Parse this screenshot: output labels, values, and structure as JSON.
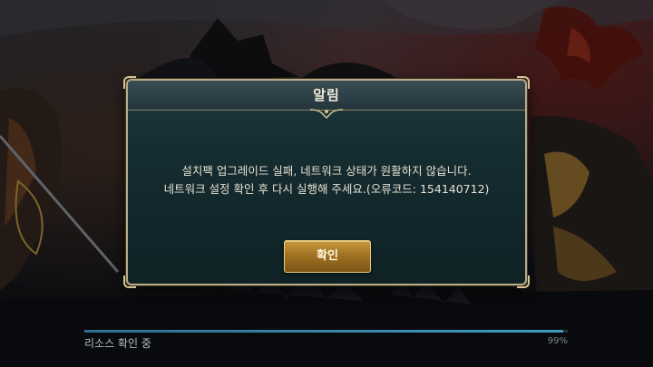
{
  "dialog": {
    "title": "알림",
    "message_line1": "설치팩 업그레이드 실패, 네트워크 상태가 원활하지 않습니다.",
    "message_line2": "네트워크 설정 확인 후 다시 실행해 주세요.(오류코드: 154140712)",
    "confirm_label": "확인"
  },
  "loading": {
    "label": "리소스 확인 중",
    "percent_text": "99%",
    "progress": 0.99
  },
  "colors": {
    "dialog_border": "#b9ab86",
    "button_gold": "#a07323",
    "progress_blue": "#3f9ac0"
  }
}
